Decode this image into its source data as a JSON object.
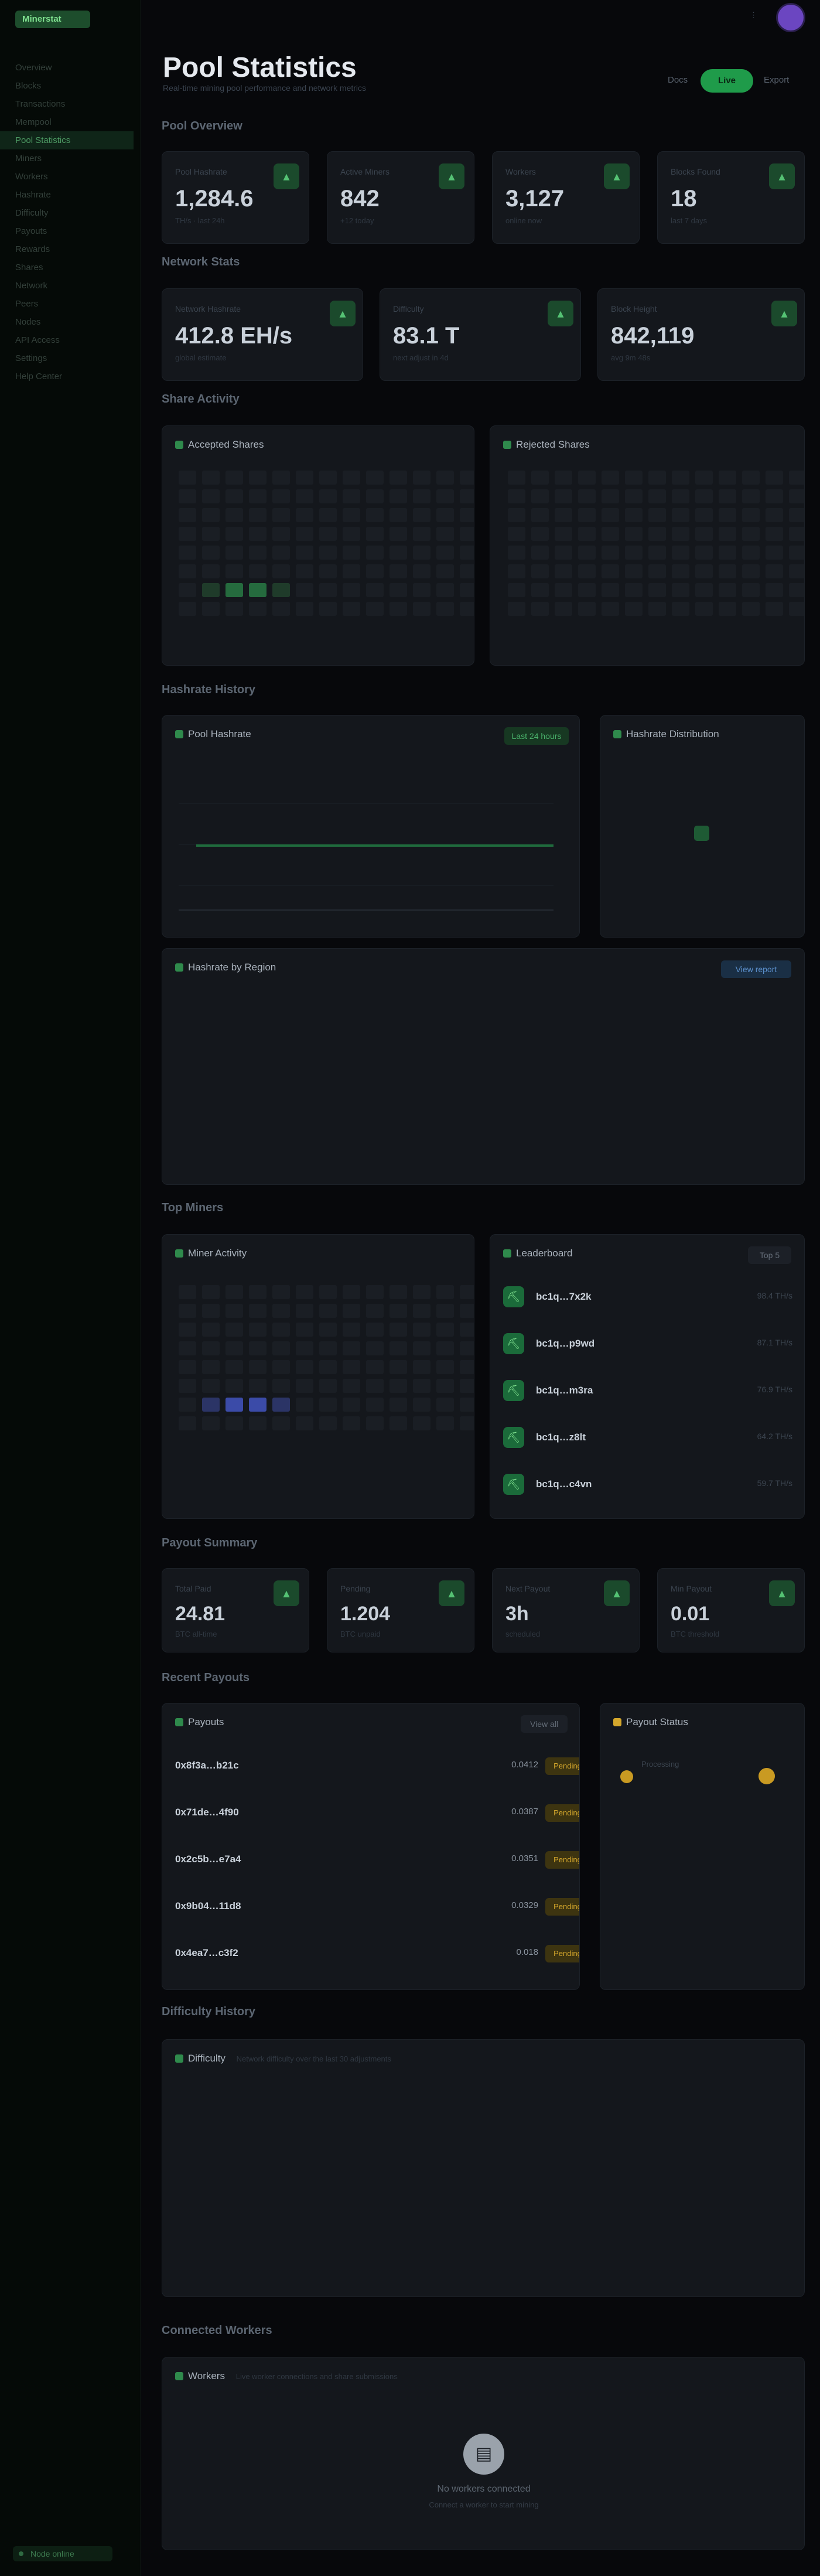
{
  "app": {
    "brand": "Minerstat",
    "footer_status": "Node online"
  },
  "sidebar": {
    "items": [
      {
        "label": "Overview",
        "active": false
      },
      {
        "label": "Blocks",
        "active": false
      },
      {
        "label": "Transactions",
        "active": false
      },
      {
        "label": "Mempool",
        "active": false
      },
      {
        "label": "Pool Statistics",
        "active": true
      },
      {
        "label": "Miners",
        "active": false
      },
      {
        "label": "Workers",
        "active": false
      },
      {
        "label": "Hashrate",
        "active": false
      },
      {
        "label": "Difficulty",
        "active": false
      },
      {
        "label": "Payouts",
        "active": false
      },
      {
        "label": "Rewards",
        "active": false
      },
      {
        "label": "Shares",
        "active": false
      },
      {
        "label": "Network",
        "active": false
      },
      {
        "label": "Peers",
        "active": false
      },
      {
        "label": "Nodes",
        "active": false
      },
      {
        "label": "API Access",
        "active": false
      },
      {
        "label": "Settings",
        "active": false
      },
      {
        "label": "Help Center",
        "active": false
      }
    ]
  },
  "header": {
    "title": "Pool Statistics",
    "subtitle": "Real-time mining pool performance and network metrics",
    "link_docs": "Docs",
    "live_label": "Live",
    "link_export": "Export"
  },
  "sections": {
    "pool_overview": "Pool Overview",
    "network_stats": "Network Stats",
    "share_activity": "Share Activity",
    "hashrate_history": "Hashrate History",
    "top_miners": "Top Miners",
    "payout_summary": "Payout Summary",
    "recent_payouts": "Recent Payouts",
    "difficulty_history": "Difficulty History",
    "connected_workers": "Connected Workers"
  },
  "pool_cards": [
    {
      "label": "Pool Hashrate",
      "value": "1,284.6",
      "sub": "TH/s · last 24h"
    },
    {
      "label": "Active Miners",
      "value": "842",
      "sub": "+12 today"
    },
    {
      "label": "Workers",
      "value": "3,127",
      "sub": "online now"
    },
    {
      "label": "Blocks Found",
      "value": "18",
      "sub": "last 7 days"
    }
  ],
  "network_cards": [
    {
      "label": "Network Hashrate",
      "value": "412.8 EH/s",
      "sub": "global estimate"
    },
    {
      "label": "Difficulty",
      "value": "83.1 T",
      "sub": "next adjust in 4d"
    },
    {
      "label": "Block Height",
      "value": "842,119",
      "sub": "avg 9m 48s"
    }
  ],
  "share_activity": {
    "accepted_title": "Accepted Shares",
    "rejected_title": "Rejected Shares"
  },
  "hashrate_history": {
    "chart_title": "Pool Hashrate",
    "range_badge": "Last 24 hours",
    "side_title": "Hashrate Distribution",
    "wide_title": "Hashrate by Region",
    "wide_badge": "View report"
  },
  "top_miners": {
    "heatmap_title": "Miner Activity",
    "list_title": "Leaderboard",
    "list_badge": "Top 5",
    "rows": [
      {
        "name": "bc1q…7x2k",
        "meta": "98.4 TH/s"
      },
      {
        "name": "bc1q…p9wd",
        "meta": "87.1 TH/s"
      },
      {
        "name": "bc1q…m3ra",
        "meta": "76.9 TH/s"
      },
      {
        "name": "bc1q…z8lt",
        "meta": "64.2 TH/s"
      },
      {
        "name": "bc1q…c4vn",
        "meta": "59.7 TH/s"
      }
    ]
  },
  "payout_cards": [
    {
      "label": "Total Paid",
      "value": "24.81",
      "sub": "BTC all-time"
    },
    {
      "label": "Pending",
      "value": "1.204",
      "sub": "BTC unpaid"
    },
    {
      "label": "Next Payout",
      "value": "3h",
      "sub": "scheduled"
    },
    {
      "label": "Min Payout",
      "value": "0.01",
      "sub": "BTC threshold"
    }
  ],
  "recent_payouts": {
    "title": "Payouts",
    "badge": "View all",
    "side_title": "Payout Status",
    "side_label": "Processing",
    "rows": [
      {
        "id": "0x8f3a…b21c",
        "amount": "0.0412",
        "status": "Pending"
      },
      {
        "id": "0x71de…4f90",
        "amount": "0.0387",
        "status": "Pending"
      },
      {
        "id": "0x2c5b…e7a4",
        "amount": "0.0351",
        "status": "Pending"
      },
      {
        "id": "0x9b04…11d8",
        "amount": "0.0329",
        "status": "Pending"
      },
      {
        "id": "0x4ea7…c3f2",
        "amount": "0.018",
        "status": "Pending"
      }
    ]
  },
  "difficulty_history": {
    "title": "Difficulty",
    "subtitle": "Network difficulty over the last 30 adjustments"
  },
  "connected_workers": {
    "title": "Workers",
    "subtitle": "Live worker connections and share submissions",
    "empty_text": "No workers connected",
    "empty_sub": "Connect a worker to start mining"
  },
  "icons": {
    "card": "chart-icon",
    "miner": "pickaxe-icon",
    "empty": "server-icon"
  },
  "colors": {
    "accent": "#1f9b4a",
    "pending": "#d4a72c",
    "avatar": "#6b46c1"
  }
}
